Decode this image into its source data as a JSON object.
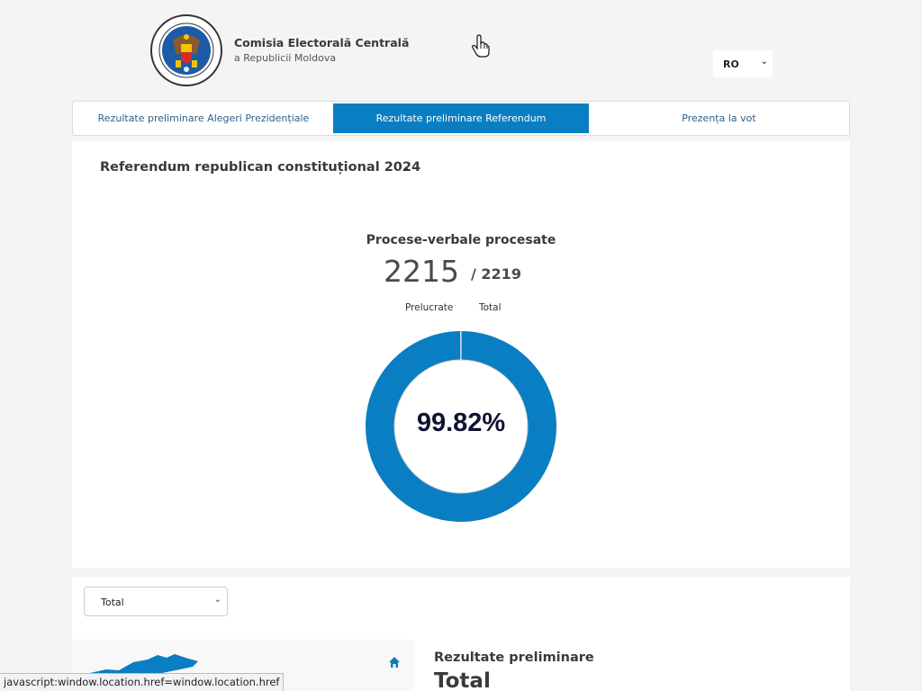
{
  "header": {
    "org_name": "Comisia Electorală Centrală",
    "org_sub": "a Republicii Moldova",
    "logo_text": "REPUBLICA MOLDOVA • COMISIA ELECTORALĂ CENTRALĂ",
    "language": "RO"
  },
  "tabs": [
    {
      "label": "Rezultate preliminare Alegeri Prezidențiale",
      "active": false
    },
    {
      "label": "Rezultate preliminare Referendum",
      "active": true
    },
    {
      "label": "Prezența la vot",
      "active": false
    }
  ],
  "referendum": {
    "title": "Referendum republican constituțional 2024",
    "pv_title": "Procese-verbale procesate",
    "processed": "2215",
    "total": "/ 2219",
    "processed_label": "Prelucrate",
    "total_label": "Total",
    "percent_text": "99.82%",
    "percent_value": 99.82,
    "accent_color": "#0a7ec2"
  },
  "results": {
    "region_select": "Total",
    "title": "Rezultate preliminare",
    "subtitle": "Total"
  },
  "statusbar": {
    "text": "javascript:window.location.href=window.location.href"
  }
}
